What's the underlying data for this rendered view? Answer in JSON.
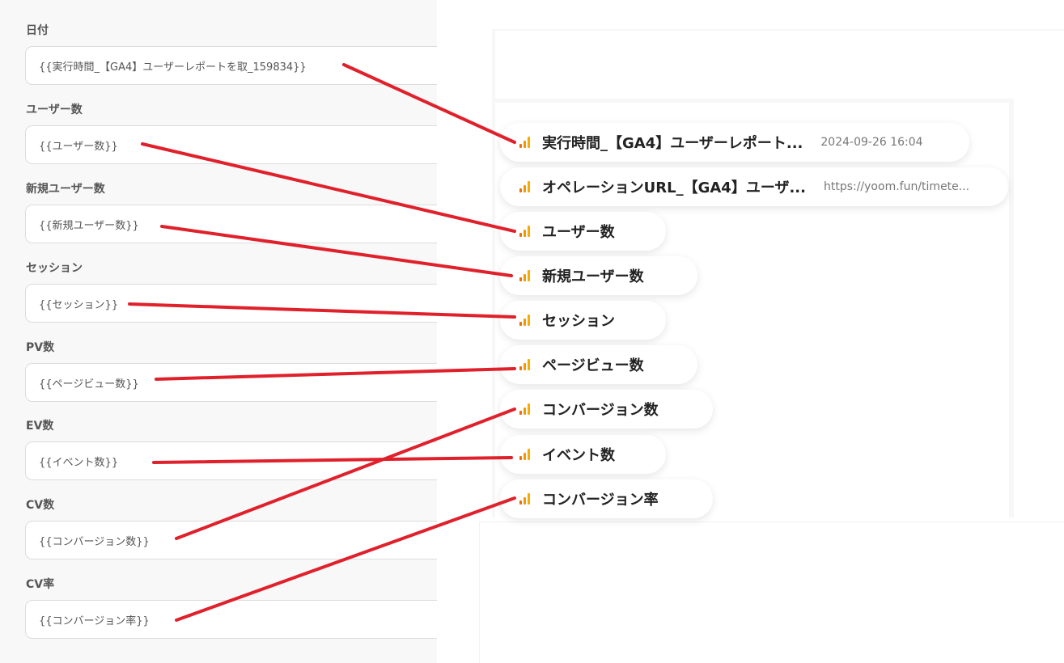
{
  "form": {
    "fields": [
      {
        "label": "日付",
        "value": "{{実行時間_【GA4】ユーザーレポートを取_159834}}"
      },
      {
        "label": "ユーザー数",
        "value": "{{ユーザー数}}"
      },
      {
        "label": "新規ユーザー数",
        "value": "{{新規ユーザー数}}"
      },
      {
        "label": "セッション",
        "value": "{{セッション}}"
      },
      {
        "label": "PV数",
        "value": "{{ページビュー数}}"
      },
      {
        "label": "EV数",
        "value": "{{イベント数}}"
      },
      {
        "label": "CV数",
        "value": "{{コンバージョン数}}"
      },
      {
        "label": "CV率",
        "value": "{{コンバージョン率}}"
      }
    ]
  },
  "picker": {
    "icon": "google-analytics-icon",
    "items": [
      {
        "label": "実行時間_【GA4】ユーザーレポート...",
        "value": "2024-09-26 16:04"
      },
      {
        "label": "オペレーションURL_【GA4】ユーザ...",
        "value": "https://yoom.fun/timete..."
      },
      {
        "label": "ユーザー数",
        "value": ""
      },
      {
        "label": "新規ユーザー数",
        "value": ""
      },
      {
        "label": "セッション",
        "value": ""
      },
      {
        "label": "ページビュー数",
        "value": ""
      },
      {
        "label": "コンバージョン数",
        "value": ""
      },
      {
        "label": "イベント数",
        "value": ""
      },
      {
        "label": "コンバージョン率",
        "value": ""
      }
    ]
  },
  "colors": {
    "annotation_line": "#e0202b",
    "ga_bar_dark": "#e8710a",
    "ga_bar_mid": "#f29900",
    "ga_bar_light": "#f9ab00"
  }
}
